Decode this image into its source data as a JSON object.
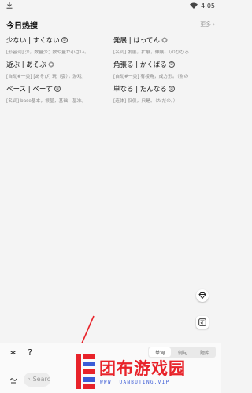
{
  "status": {
    "time": "4:05"
  },
  "header": {
    "title": "今日热搜",
    "more": "更多"
  },
  "hot_words": [
    {
      "word": "少ない | すくない",
      "badge": "③",
      "def": "[形容词] 少，数量少；数や量が小さい。"
    },
    {
      "word": "発展 | はってん",
      "badge": "gear",
      "def": "[名词] 发展，扩展，伸展。（のびひろ"
    },
    {
      "word": "遊ぶ | あそぶ",
      "badge": "gear",
      "def": "[自动#一类] [あそび] 玩（耍），游戏，"
    },
    {
      "word": "角張る | かくばる",
      "badge": "③",
      "def": "[自动#一类] 有棱角，成方形。（物の"
    },
    {
      "word": "ベース | ベーす",
      "badge": "①",
      "def": "[名词] base基本，根基，基础，基准。"
    },
    {
      "word": "単なる | たんなる",
      "badge": "①",
      "def": "[连体] 仅仅，只是。（ただの。）"
    }
  ],
  "bottom": {
    "keys": [
      "∗",
      "?"
    ],
    "tabs": [
      "单词",
      "例句",
      "题库"
    ],
    "active_tab": 0,
    "search_placeholder": "Searc"
  },
  "watermark": {
    "brand": "团布游戏园",
    "url": "WWW.TUANBUTING.VIP"
  },
  "colors": {
    "watermark_red": "#e8232a",
    "watermark_blue": "#3b5bd6"
  }
}
